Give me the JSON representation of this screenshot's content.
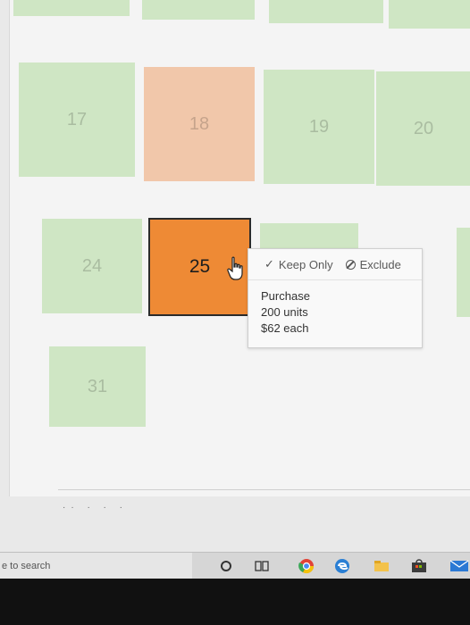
{
  "calendar": {
    "days": [
      "17",
      "18",
      "19",
      "20",
      "24",
      "25",
      "31"
    ],
    "selected_day": "25"
  },
  "tooltip": {
    "keep_only_label": "Keep Only",
    "exclude_label": "Exclude",
    "lines": [
      "Purchase",
      "200 units",
      "$62 each"
    ]
  },
  "taskbar": {
    "search_placeholder": "e to search",
    "icons": [
      "cortana-circle-icon",
      "task-view-icon",
      "chrome-icon",
      "edge-icon",
      "file-explorer-icon",
      "store-icon",
      "mail-icon"
    ]
  },
  "colors": {
    "low_cell": "#cfe6c4",
    "mid_cell": "#f1c7aa",
    "selected_cell": "#ee8a35"
  }
}
